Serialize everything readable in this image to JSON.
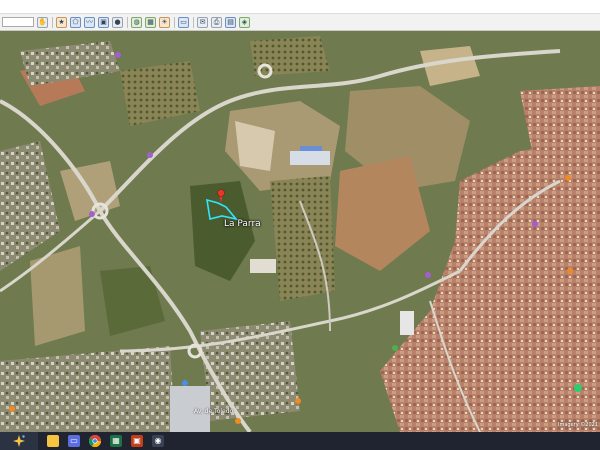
{
  "map": {
    "placemark_label": "La Parra",
    "street_label": "Av. de Toledo",
    "imagery_credit": "Imagery ©2021",
    "colors": {
      "terrain": "#6f7a4f",
      "road": "#d9d6cc",
      "urban": "#b07a62",
      "boundary": "#2fe6ff",
      "placemark_pin": "#e23a2a"
    }
  },
  "toolbar": {
    "icons": [
      "search-field",
      "hand-icon",
      "star-icon",
      "polygon-icon",
      "path-icon",
      "overlay-icon",
      "globe-icon",
      "image-icon",
      "history-icon",
      "sun-icon",
      "ruler-icon",
      "email-icon",
      "print-icon",
      "save-icon",
      "maps-icon"
    ]
  },
  "taskbar": {
    "icons": [
      "start-sparkle-icon",
      "file-explorer-icon",
      "chat-icon",
      "chrome-icon",
      "excel-icon",
      "powerpoint-icon",
      "earth-icon"
    ],
    "colors": {
      "background": "#1f2430",
      "explorer": "#f5c542",
      "chrome": "#4285f4",
      "excel": "#1e7145",
      "powerpoint": "#c43e1c"
    }
  }
}
